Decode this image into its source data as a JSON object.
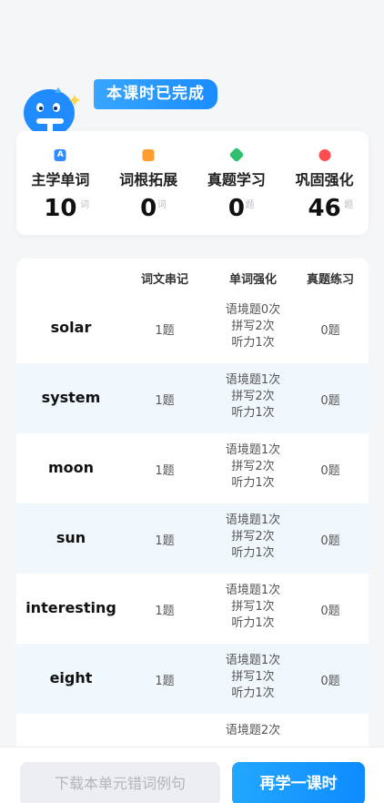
{
  "completion": {
    "badge": "本课时已完成"
  },
  "stats": [
    {
      "label": "主学单词",
      "value": "10",
      "unit": "词",
      "icon": "letter-a-icon",
      "color": "#2f8cff"
    },
    {
      "label": "词根拓展",
      "value": "0",
      "unit": "词",
      "icon": "root-expand-icon",
      "color": "#ff9d2e"
    },
    {
      "label": "真题学习",
      "value": "0",
      "unit": "题",
      "icon": "exam-study-icon",
      "color": "#2fbf6d"
    },
    {
      "label": "巩固强化",
      "value": "46",
      "unit": "题",
      "icon": "reinforce-icon",
      "color": "#ff4d4f"
    }
  ],
  "table": {
    "headers": [
      "词文串记",
      "单词强化",
      "真题练习"
    ],
    "rows": [
      {
        "word": "solar",
        "c1": "1题",
        "c2": [
          "语境题0次",
          "拼写2次",
          "听力1次"
        ],
        "c3": "0题"
      },
      {
        "word": "system",
        "c1": "1题",
        "c2": [
          "语境题1次",
          "拼写2次",
          "听力1次"
        ],
        "c3": "0题"
      },
      {
        "word": "moon",
        "c1": "1题",
        "c2": [
          "语境题1次",
          "拼写2次",
          "听力1次"
        ],
        "c3": "0题"
      },
      {
        "word": "sun",
        "c1": "1题",
        "c2": [
          "语境题1次",
          "拼写2次",
          "听力1次"
        ],
        "c3": "0题"
      },
      {
        "word": "interesting",
        "c1": "1题",
        "c2": [
          "语境题1次",
          "拼写1次",
          "听力1次"
        ],
        "c3": "0题"
      },
      {
        "word": "eight",
        "c1": "1题",
        "c2": [
          "语境题1次",
          "拼写1次",
          "听力1次"
        ],
        "c3": "0题"
      },
      {
        "word": "",
        "c1": "",
        "c2": [
          "语境题2次",
          "",
          ""
        ],
        "c3": ""
      }
    ]
  },
  "footer": {
    "download_label": "下载本单元错词例句",
    "next_label": "再学一课时"
  }
}
